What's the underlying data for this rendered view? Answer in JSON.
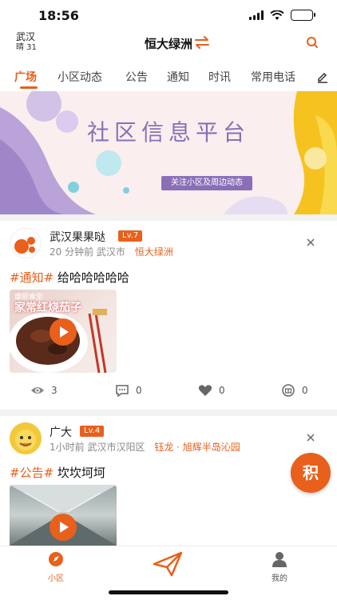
{
  "status": {
    "time": "18:56"
  },
  "header": {
    "city": "武汉",
    "weather": "晴 31",
    "community": "恒大绿洲"
  },
  "tabs": [
    {
      "label": "广场",
      "active": true
    },
    {
      "label": "小区动态"
    },
    {
      "label": "公告"
    },
    {
      "label": "通知"
    },
    {
      "label": "时讯"
    },
    {
      "label": "常用电话"
    }
  ],
  "banner": {
    "title": "社区信息平台",
    "subtitle": "关注小区及周边动态"
  },
  "posts": [
    {
      "author": "武汉果果哒",
      "level": "Lv.7",
      "time": "20 分钟前",
      "city": "武汉市",
      "location": "恒大绿洲",
      "tag": "#通知#",
      "text": "给哈哈哈哈哈",
      "thumb_label": "康熙食堂",
      "thumb_title": "家常红烧茄子",
      "views": "3",
      "comments": "0",
      "likes": "0",
      "shares": "0"
    },
    {
      "author": "广大",
      "level": "Lv.4",
      "time": "1小时前",
      "city": "武汉市汉阳区",
      "location": "钰龙 · 旭辉半岛沁园",
      "tag": "#公告#",
      "text": "坎坎坷坷"
    }
  ],
  "fab": {
    "label": "积"
  },
  "nav": {
    "home": "小区",
    "mine": "我的"
  },
  "colors": {
    "accent": "#e8601c",
    "banner_purple": "#8a6fb8"
  }
}
